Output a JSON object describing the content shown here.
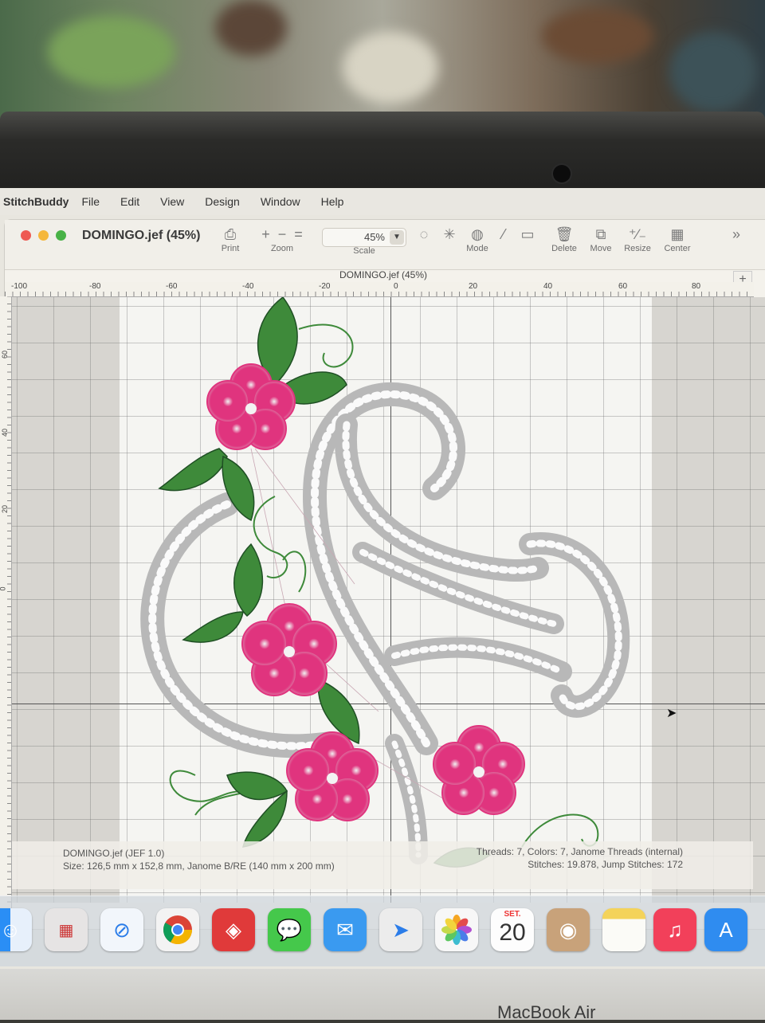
{
  "menubar": {
    "app_name": "StitchBuddy",
    "items": [
      "File",
      "Edit",
      "View",
      "Design",
      "Window",
      "Help"
    ]
  },
  "window": {
    "title": "DOMINGO.jef (45%)",
    "subtitle": "DOMINGO.jef (45%)"
  },
  "toolbar": {
    "print_label": "Print",
    "zoom_label": "Zoom",
    "scale_label": "Scale",
    "scale_value": "45%",
    "mode_label": "Mode",
    "delete_label": "Delete",
    "move_label": "Move",
    "resize_label": "Resize",
    "center_label": "Center",
    "overflow_glyph": "»",
    "add_glyph": "+"
  },
  "ruler_top": [
    "-100",
    "-80",
    "-60",
    "-40",
    "-20",
    "0",
    "20",
    "40",
    "60",
    "80"
  ],
  "ruler_left": [
    "60",
    "40",
    "20",
    "0"
  ],
  "status": {
    "file_info": "DOMINGO.jef (JEF 1.0)",
    "size_info": "Size: 126,5 mm x 152,8 mm, Janome B/RE (140 mm x 200 mm)",
    "threads_info": "Threads: 7, Colors: 7, Janome Threads (internal)",
    "stitches_info": "Stitches: 19.878, Jump Stitches: 172"
  },
  "dock": {
    "calendar_month": "SET.",
    "calendar_day": "20"
  },
  "laptop_label": "MacBook Air",
  "colors": {
    "flower_pink": "#e0347e",
    "leaf_green": "#3e8a3a",
    "lace_gray": "#b8b8b8",
    "traffic_red": "#ee5a52",
    "traffic_yellow": "#f5b73b",
    "traffic_green": "#48b246"
  }
}
